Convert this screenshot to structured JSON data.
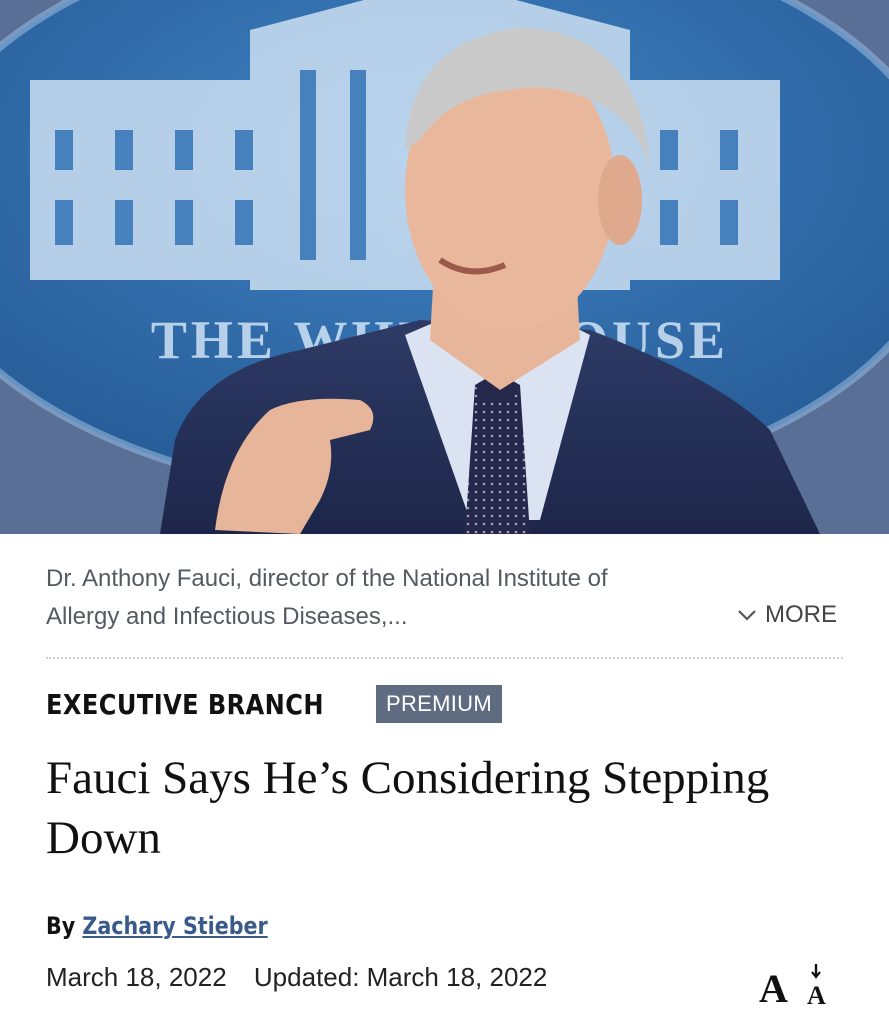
{
  "hero": {
    "seal_text": "THE WHITE HOUSE",
    "seal_color": "#2f6aa8"
  },
  "caption": {
    "text": "Dr. Anthony Fauci, director of the National Institute of Allergy and Infectious Diseases,...",
    "more_label": "MORE",
    "more_icon": "chevron-down-icon"
  },
  "article": {
    "section": "EXECUTIVE BRANCH",
    "badge": "PREMIUM",
    "badge_color": "#5f6b80",
    "title": "Fauci Says He’s Considering Stepping Down",
    "byline_prefix": "By",
    "author": "Zachary Stieber",
    "author_color": "#3a5a8c",
    "date": "March 18, 2022",
    "updated": "Updated: March 18, 2022",
    "font_size_icon": "font-size-icon"
  }
}
